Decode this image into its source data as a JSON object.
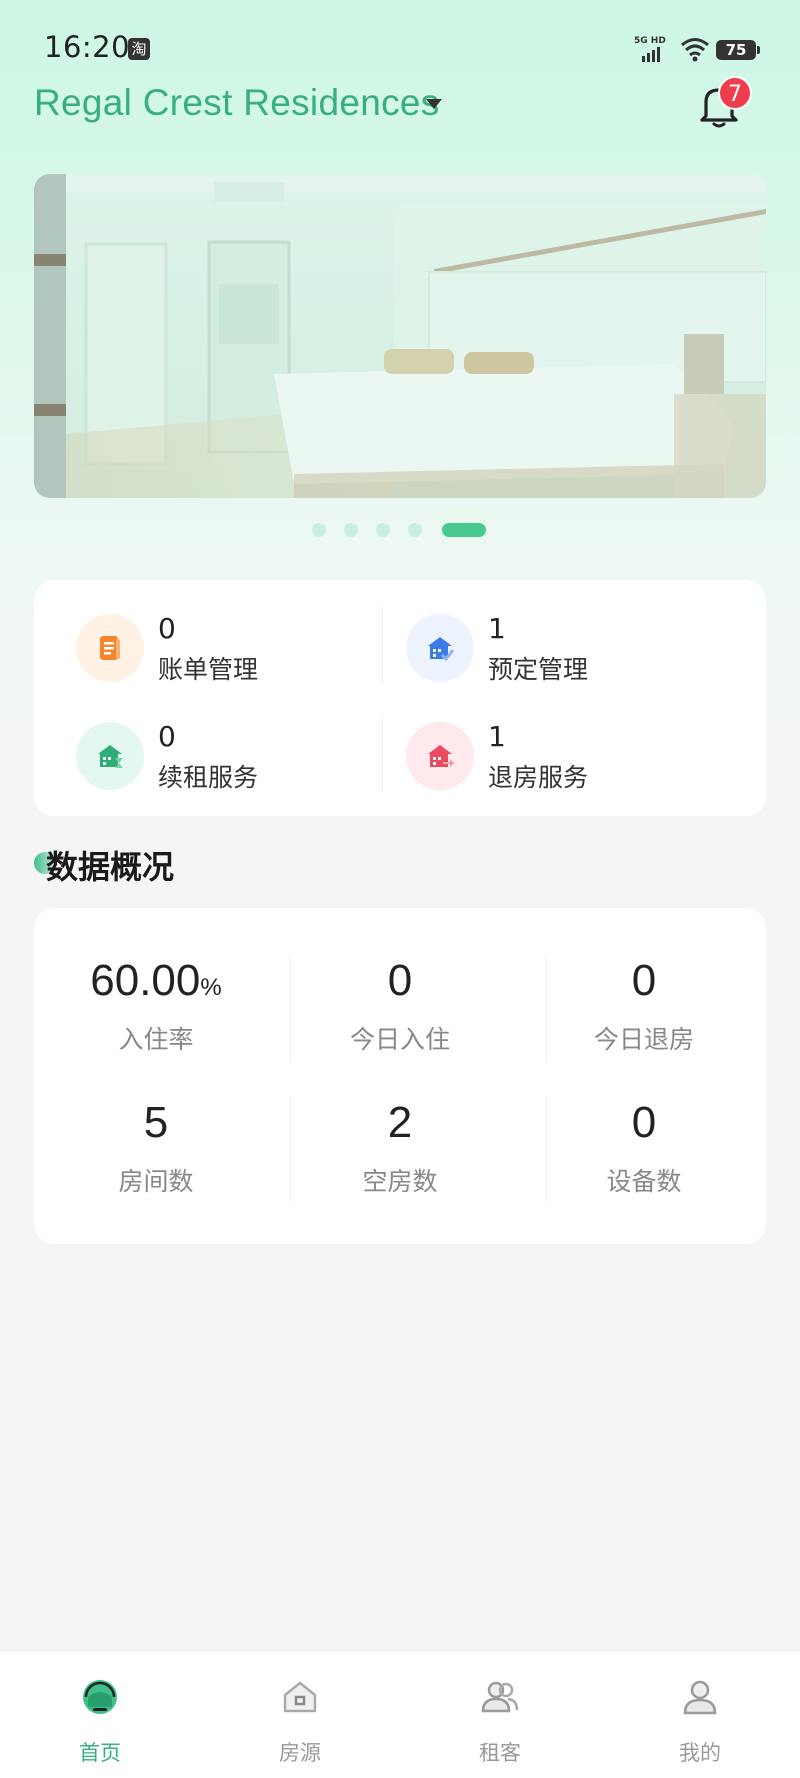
{
  "status_bar": {
    "time": "16:20",
    "app_icon": "淘",
    "network": "5G HD",
    "battery": "75"
  },
  "header": {
    "property_name": "Regal Crest Residences",
    "notification_count": "7"
  },
  "banner": {
    "dots": 5,
    "active_dot": 4
  },
  "quick_actions": [
    {
      "count": "0",
      "label": "账单管理",
      "icon": "bill-icon",
      "color": "#f5862c",
      "bg": "#fff1e4"
    },
    {
      "count": "1",
      "label": "预定管理",
      "icon": "booking-icon",
      "color": "#3a7be8",
      "bg": "#edf3ff"
    },
    {
      "count": "0",
      "label": "续租服务",
      "icon": "renew-icon",
      "color": "#2fae76",
      "bg": "#e3f8ef"
    },
    {
      "count": "1",
      "label": "退房服务",
      "icon": "checkout-icon",
      "color": "#ea4a5f",
      "bg": "#ffe9ed"
    }
  ],
  "overview": {
    "title": "数据概况",
    "stats": [
      {
        "value": "60.00",
        "unit": "%",
        "label": "入住率"
      },
      {
        "value": "0",
        "unit": "",
        "label": "今日入住"
      },
      {
        "value": "0",
        "unit": "",
        "label": "今日退房"
      },
      {
        "value": "5",
        "unit": "",
        "label": "房间数"
      },
      {
        "value": "2",
        "unit": "",
        "label": "空房数"
      },
      {
        "value": "0",
        "unit": "",
        "label": "设备数"
      }
    ]
  },
  "nav": [
    {
      "label": "首页",
      "icon": "home-icon",
      "active": true
    },
    {
      "label": "房源",
      "icon": "house-icon",
      "active": false
    },
    {
      "label": "租客",
      "icon": "tenants-icon",
      "active": false
    },
    {
      "label": "我的",
      "icon": "profile-icon",
      "active": false
    }
  ],
  "colors": {
    "accent": "#37b07e",
    "badge": "#ee3d4b"
  }
}
